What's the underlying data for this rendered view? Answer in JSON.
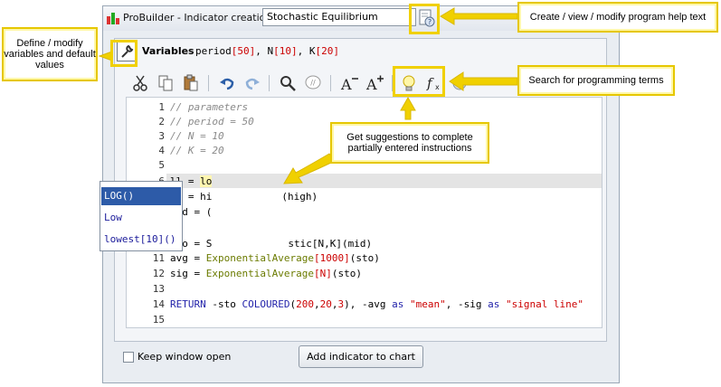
{
  "window": {
    "title": "ProBuilder - Indicator creation",
    "indicator_name": "Stochastic Equilibrium"
  },
  "variables": {
    "label": "Variables",
    "parts": [
      "period",
      "[50]",
      ", N",
      "[10]",
      ", K",
      "[20]"
    ]
  },
  "toolbar": {
    "buttons": [
      "cut-icon",
      "copy-icon",
      "paste-icon",
      "undo-icon",
      "redo-icon",
      "search-icon",
      "comment-icon",
      "decrease-font-icon",
      "increase-font-icon",
      "lightbulb-icon",
      "function-icon",
      "color-wheel-icon"
    ]
  },
  "editor": {
    "line_numbers": [
      "1",
      "2",
      "3",
      "4",
      "5",
      "6",
      "7",
      "8",
      "9",
      "10",
      "11",
      "12",
      "13",
      "14",
      "15"
    ],
    "lines": {
      "l1": "// parameters",
      "l2": "// period = 50",
      "l3": "// N = 10",
      "l4": "// K = 20",
      "l6a": "ll = ",
      "l6b": "lo",
      "l7a": "hh = hi",
      "l7b": "(high)",
      "l8": "mid = (",
      "l10a": "sto = S",
      "l10b": "stic[N,K](mid)",
      "l11a": "avg = ",
      "l11b": "ExponentialAverage",
      "l11c": "[1000]",
      "l11d": "(sto)",
      "l12a": "sig = ",
      "l12b": "ExponentialAverage",
      "l12c": "[N]",
      "l12d": "(sto)",
      "l14a": "RETURN",
      "l14b": " -sto ",
      "l14c": "COLOURED",
      "l14d": "(",
      "l14e": "200",
      "l14f": ",",
      "l14g": "20",
      "l14h": ",",
      "l14i": "3",
      "l14j": "), -avg ",
      "l14k": "as",
      "l14l": " ",
      "l14m": "\"mean\"",
      "l14n": ", -sig ",
      "l14o": "as",
      "l14p": " ",
      "l14q": "\"signal line\""
    }
  },
  "autocomplete": {
    "items": [
      "LOG()",
      "Low",
      "lowest[10]()"
    ],
    "selected_index": 0
  },
  "footer": {
    "keep_open_label": "Keep window open",
    "add_button": "Add indicator to chart"
  },
  "callouts": {
    "help": "Create / view / modify program help text",
    "variables": "Define / modify variables and default values",
    "search": "Search for programming terms",
    "suggestions": "Get suggestions to complete partially entered instructions"
  },
  "colors": {
    "callout_border": "#e6c700",
    "selection": "#2d5ba8"
  }
}
